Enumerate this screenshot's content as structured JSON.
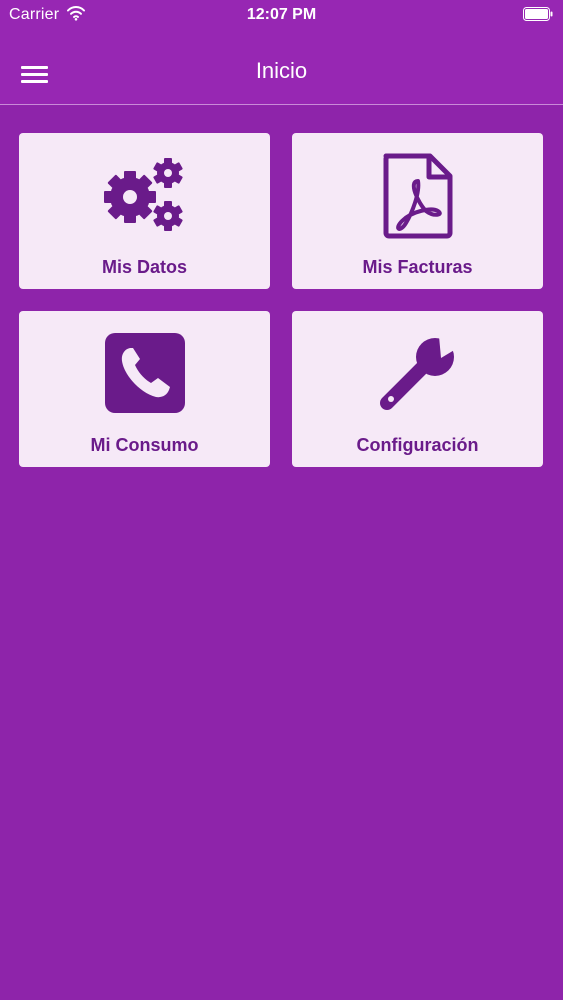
{
  "status_bar": {
    "carrier": "Carrier",
    "time": "12:07 PM",
    "wifi_icon": "wifi-icon",
    "battery_icon": "battery-icon"
  },
  "navbar": {
    "title": "Inicio",
    "menu_icon": "hamburger-menu-icon"
  },
  "tiles": [
    {
      "label": "Mis Datos",
      "icon": "gears-icon"
    },
    {
      "label": "Mis Facturas",
      "icon": "pdf-document-icon"
    },
    {
      "label": "Mi Consumo",
      "icon": "phone-icon"
    },
    {
      "label": "Configuración",
      "icon": "wrench-icon"
    }
  ],
  "colors": {
    "background": "#8e24aa",
    "navbar": "#9727b3",
    "tile_background": "#f6e9f7",
    "tile_foreground": "#6a1b8a"
  }
}
